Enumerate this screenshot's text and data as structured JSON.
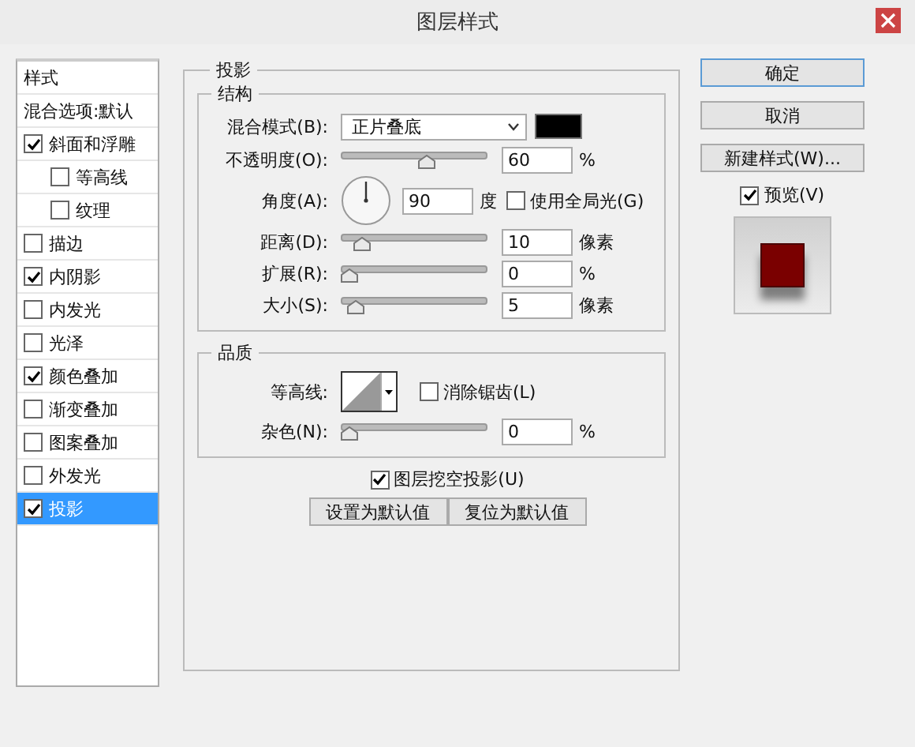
{
  "window": {
    "title": "图层样式"
  },
  "sidebar": {
    "items": [
      {
        "label": "样式",
        "kind": "header",
        "selected": false
      },
      {
        "label": "混合选项:默认",
        "kind": "header",
        "selected": false
      },
      {
        "label": "斜面和浮雕",
        "kind": "check",
        "checked": true,
        "selected": false,
        "children": [
          {
            "label": "等高线",
            "kind": "check",
            "checked": false,
            "selected": false
          },
          {
            "label": "纹理",
            "kind": "check",
            "checked": false,
            "selected": false
          }
        ]
      },
      {
        "label": "描边",
        "kind": "check",
        "checked": false,
        "selected": false
      },
      {
        "label": "内阴影",
        "kind": "check",
        "checked": true,
        "selected": false
      },
      {
        "label": "内发光",
        "kind": "check",
        "checked": false,
        "selected": false
      },
      {
        "label": "光泽",
        "kind": "check",
        "checked": false,
        "selected": false
      },
      {
        "label": "颜色叠加",
        "kind": "check",
        "checked": true,
        "selected": false
      },
      {
        "label": "渐变叠加",
        "kind": "check",
        "checked": false,
        "selected": false
      },
      {
        "label": "图案叠加",
        "kind": "check",
        "checked": false,
        "selected": false
      },
      {
        "label": "外发光",
        "kind": "check",
        "checked": false,
        "selected": false
      },
      {
        "label": "投影",
        "kind": "check",
        "checked": true,
        "selected": true
      }
    ]
  },
  "panel": {
    "title": "投影",
    "groups": [
      {
        "title": "结构",
        "rows": [
          {
            "kind": "select",
            "label": "混合模式(B):",
            "value": "正片叠底",
            "color": "#000000"
          },
          {
            "kind": "slider",
            "label": "不透明度(O):",
            "level": 0.6,
            "value": "60",
            "unit": "%"
          },
          {
            "kind": "angle",
            "label": "角度(A):",
            "value": "90",
            "unit": "度",
            "option": {
              "label": "使用全局光(G)",
              "checked": false
            }
          },
          {
            "kind": "slider",
            "label": "距离(D):",
            "level": 0.1,
            "value": "10",
            "unit": "像素"
          },
          {
            "kind": "slider",
            "label": "扩展(R):",
            "level": 0,
            "value": "0",
            "unit": "%"
          },
          {
            "kind": "slider",
            "label": "大小(S):",
            "level": 0.05,
            "value": "5",
            "unit": "像素"
          }
        ]
      },
      {
        "title": "品质",
        "rows": [
          {
            "kind": "contour",
            "label": "等高线:",
            "option": {
              "label": "消除锯齿(L)",
              "checked": false
            }
          },
          {
            "kind": "slider",
            "label": "杂色(N):",
            "level": 0,
            "value": "0",
            "unit": "%"
          }
        ]
      }
    ],
    "knockout": {
      "label": "图层挖空投影(U)",
      "checked": true
    },
    "buttons": [
      "设置为默认值",
      "复位为默认值"
    ]
  },
  "actions": {
    "buttons": [
      {
        "label": "确定",
        "default": true
      },
      {
        "label": "取消",
        "default": false
      },
      {
        "label": "新建样式(W)...",
        "default": false
      }
    ],
    "preview": {
      "label": "预览(V)",
      "checked": true
    }
  }
}
